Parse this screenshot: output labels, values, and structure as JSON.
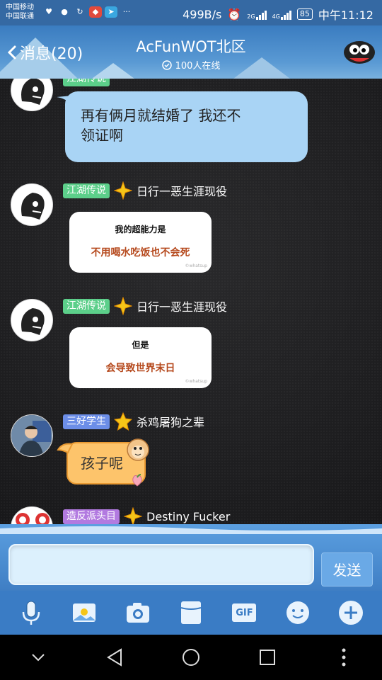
{
  "status_bar": {
    "carrier1": "中国移动",
    "carrier2": "中国联通",
    "speed": "499B/s",
    "net1": "2G",
    "net2": "4G",
    "battery": "85",
    "time": "中午11:12"
  },
  "header": {
    "back_label": "消息(20)",
    "title": "AcFunWOT北区",
    "online": "100人在线"
  },
  "messages": [
    {
      "type": "text",
      "text_line1": "再有俩月就结婚了  我还不",
      "text_line2": "领证啊"
    },
    {
      "type": "image",
      "tag": "江湖传说",
      "name": "日行一恶生涯现役",
      "img_line1": "我的超能力是",
      "img_line2": "不用喝水吃饭也不会死",
      "watermark": "©whatsup"
    },
    {
      "type": "image",
      "tag": "江湖传说",
      "name": "日行一恶生涯现役",
      "img_line1": "但是",
      "img_line2": "会导致世界末日",
      "watermark": "©whatsup"
    },
    {
      "type": "text",
      "tag": "三好学生",
      "name": "杀鸡屠狗之辈",
      "text": "孩子呢"
    },
    {
      "type": "partial",
      "tag": "造反派头目",
      "name": "Destiny Fucker"
    }
  ],
  "input": {
    "placeholder": "",
    "send_label": "发送"
  },
  "toolbar": {
    "gif_label": "GIF"
  },
  "colors": {
    "primary": "#3a7cc5",
    "bubble": "#a9d4f5",
    "tag_green": "#5ccf8a",
    "tag_blue": "#6c8ee8",
    "tag_purple": "#b27ae0"
  }
}
